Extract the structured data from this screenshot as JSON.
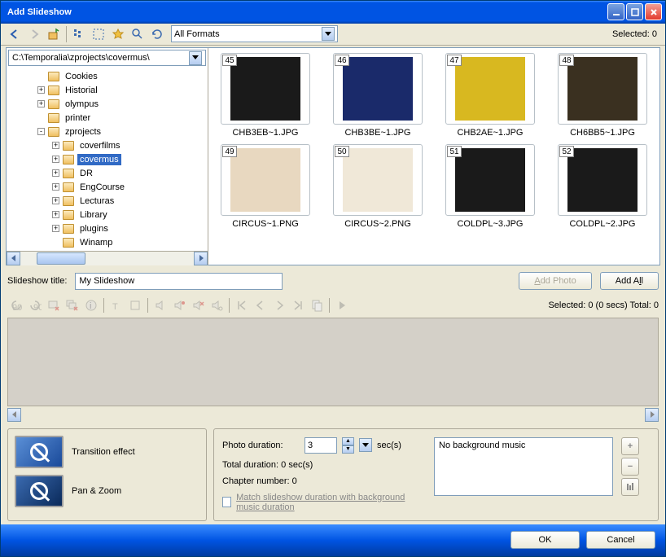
{
  "title": "Add Slideshow",
  "toolbar": {
    "format_label": "All Formats",
    "selected_label": "Selected: 0"
  },
  "path": "C:\\Temporalia\\zprojects\\covermus\\",
  "tree": [
    {
      "label": "Cookies",
      "depth": 1,
      "exp": ""
    },
    {
      "label": "Historial",
      "depth": 1,
      "exp": "+"
    },
    {
      "label": "olympus",
      "depth": 1,
      "exp": "+"
    },
    {
      "label": "printer",
      "depth": 1,
      "exp": ""
    },
    {
      "label": "zprojects",
      "depth": 1,
      "exp": "-"
    },
    {
      "label": "coverfilms",
      "depth": 2,
      "exp": "+"
    },
    {
      "label": "covermus",
      "depth": 2,
      "exp": "+",
      "sel": true
    },
    {
      "label": "DR",
      "depth": 2,
      "exp": "+"
    },
    {
      "label": "EngCourse",
      "depth": 2,
      "exp": "+"
    },
    {
      "label": "Lecturas",
      "depth": 2,
      "exp": "+"
    },
    {
      "label": "Library",
      "depth": 2,
      "exp": "+"
    },
    {
      "label": "plugins",
      "depth": 2,
      "exp": "+"
    },
    {
      "label": "Winamp",
      "depth": 2,
      "exp": ""
    }
  ],
  "thumbs": [
    {
      "num": "45",
      "label": "CHB3EB~1.JPG",
      "bg": "#1a1a1a"
    },
    {
      "num": "46",
      "label": "CHB3BE~1.JPG",
      "bg": "#1a2a6a"
    },
    {
      "num": "47",
      "label": "CHB2AE~1.JPG",
      "bg": "#d8b820"
    },
    {
      "num": "48",
      "label": "CH6BB5~1.JPG",
      "bg": "#3a3020"
    },
    {
      "num": "49",
      "label": "CIRCUS~1.PNG",
      "bg": "#e8d8c0"
    },
    {
      "num": "50",
      "label": "CIRCUS~2.PNG",
      "bg": "#f0e8d8"
    },
    {
      "num": "51",
      "label": "COLDPL~3.JPG",
      "bg": "#1a1a1a"
    },
    {
      "num": "52",
      "label": "COLDPL~2.JPG",
      "bg": "#1a1a1a"
    }
  ],
  "slideshow": {
    "title_label": "Slideshow title:",
    "title_value": "My Slideshow",
    "add_photo": "Add Photo",
    "add_all": "Add All"
  },
  "editor_status": "Selected: 0 (0 secs)  Total: 0",
  "fx": {
    "transition": "Transition effect",
    "panzoom": "Pan & Zoom"
  },
  "settings": {
    "photo_dur_label": "Photo duration:",
    "photo_dur_value": "3",
    "secs": "sec(s)",
    "total_dur": "Total duration: 0 sec(s)",
    "chapter": "Chapter number: 0",
    "match": "Match slideshow duration with background music duration",
    "music": "No background music"
  },
  "footer": {
    "ok": "OK",
    "cancel": "Cancel"
  }
}
